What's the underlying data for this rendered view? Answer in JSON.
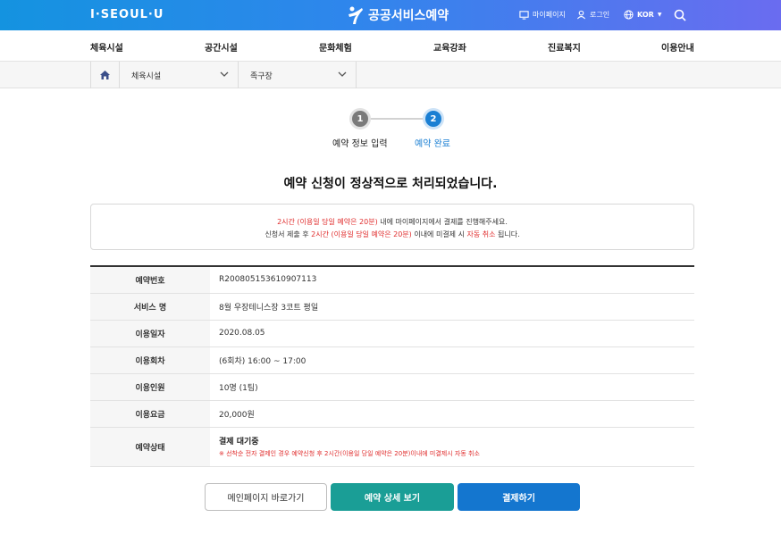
{
  "header": {
    "logo": "I·SEOUL·U",
    "brand": "공공서비스예약",
    "mypage": "마이페이지",
    "login": "로그인",
    "lang": "KOR"
  },
  "nav": [
    "체육시설",
    "공간시설",
    "문화체험",
    "교육강좌",
    "진료복지",
    "이용안내"
  ],
  "breadcrumb": {
    "category": "체육시설",
    "subcategory": "족구장"
  },
  "steps": [
    {
      "num": "1",
      "label": "예약 정보 입력"
    },
    {
      "num": "2",
      "label": "예약 완료"
    }
  ],
  "title": "예약 신청이 정상적으로 처리되었습니다.",
  "notice": {
    "line1_red": "2시간 (이용일 당일 예약은 20분)",
    "line1_rest": " 내에 마이페이지에서 결제를 진행해주세요.",
    "line2_pre": "신청서 제출 후 ",
    "line2_red": "2시간 (이용일 당일 예약은 20분)",
    "line2_mid": " 이내에 미결제 시 ",
    "line2_red2": "자동 취소",
    "line2_post": " 됩니다."
  },
  "details": {
    "rows": [
      {
        "label": "예약번호",
        "value": "R200805153610907113"
      },
      {
        "label": "서비스 명",
        "value": "8월 우장테니스장 3코트 평일"
      },
      {
        "label": "이용일자",
        "value": "2020.08.05"
      },
      {
        "label": "이용회차",
        "value": "(6회차) 16:00 ~ 17:00"
      },
      {
        "label": "이용인원",
        "value": "10명 (1팀)"
      },
      {
        "label": "이용요금",
        "value": "20,000원"
      }
    ],
    "status_label": "예약상태",
    "status_value": "결제 대기중",
    "status_note": "※ 선착순 전자 결제인 경우 예약신청 후 2시간(이용일 당일 예약은 20분)이내에 미결제시 자동 취소"
  },
  "buttons": {
    "main": "메인페이지 바로가기",
    "detail": "예약 상세 보기",
    "pay": "결제하기"
  },
  "colors": {
    "accent_blue": "#1476cf",
    "teal": "#1a9e96",
    "warning_red": "#e02d2d"
  }
}
